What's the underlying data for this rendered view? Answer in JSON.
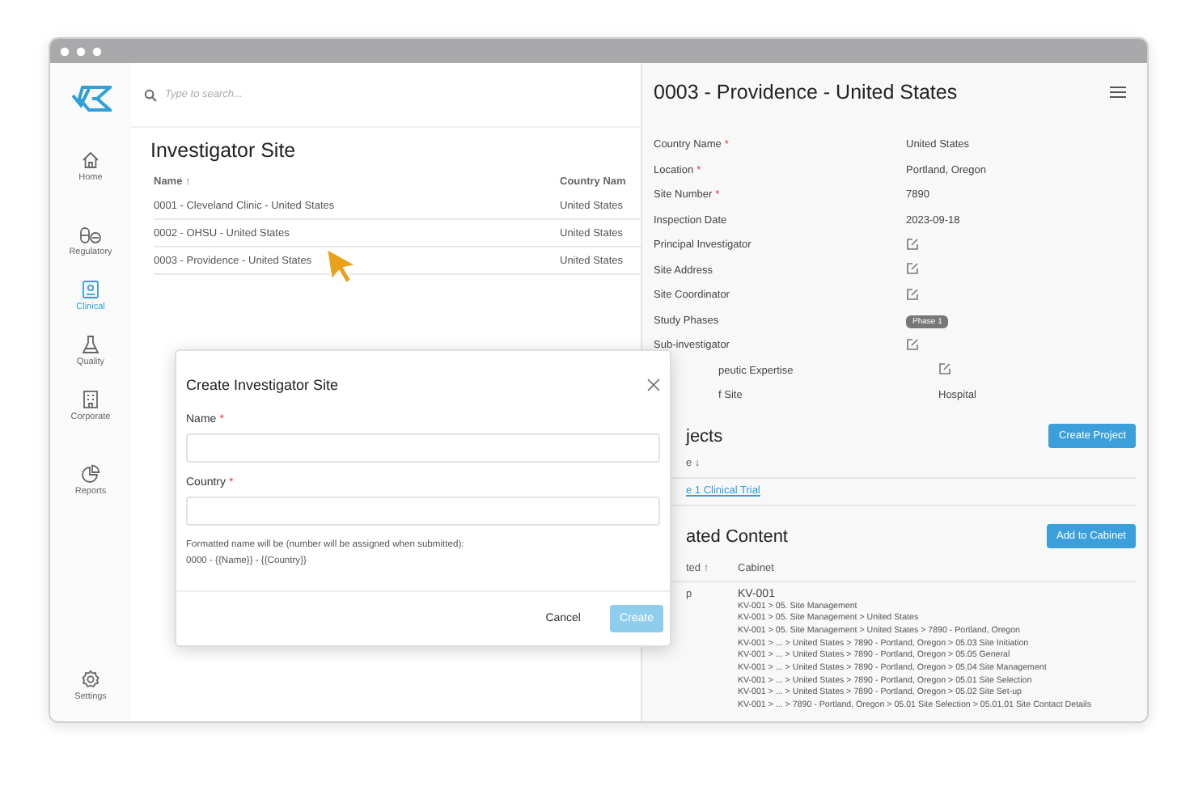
{
  "sidebar": {
    "groups": [
      [
        {
          "label": "Home",
          "selected": false
        }
      ],
      [
        {
          "label": "Regulatory",
          "selected": false
        },
        {
          "label": "Clinical",
          "selected": true
        },
        {
          "label": "Quality",
          "selected": false
        },
        {
          "label": "Corporate",
          "selected": false
        }
      ],
      [
        {
          "label": "Reports",
          "selected": false
        }
      ]
    ],
    "footer": {
      "label": "Settings",
      "selected": false
    }
  },
  "search": {
    "placeholder": "Type to search..."
  },
  "list": {
    "title": "Investigator Site",
    "columns": [
      "Name ↑",
      "Country Nam"
    ],
    "rows": [
      [
        "0001 - Cleveland Clinic - United States",
        "United States"
      ],
      [
        "0002 - OHSU - United States",
        "United States"
      ],
      [
        "0003 - Providence - United States",
        "United States"
      ]
    ]
  },
  "detail": {
    "title": "0003 - Providence - United States",
    "fields": [
      {
        "label": "Country Name",
        "required_mark": "*",
        "kind": "text",
        "value": "United States"
      },
      {
        "label": "Location",
        "required_mark": "*",
        "kind": "text",
        "value": "Portland, Oregon"
      },
      {
        "label": "Site Number",
        "required_mark": "*",
        "kind": "text",
        "value": "7890"
      },
      {
        "label": "Inspection Date",
        "kind": "text",
        "value": "2023-09-18"
      },
      {
        "label": "Principal Investigator",
        "kind": "edit"
      },
      {
        "label": "Site Address",
        "kind": "edit"
      },
      {
        "label": "Site Coordinator",
        "kind": "edit"
      },
      {
        "label": "Study Phases",
        "kind": "badge",
        "value": "Phase 1"
      },
      {
        "label": "Sub-investigator",
        "kind": "edit"
      },
      {
        "label": "peutic Expertise",
        "kind": "edit",
        "covered": true
      },
      {
        "label": "f Site",
        "kind": "text",
        "value": "Hospital",
        "covered": true
      }
    ]
  },
  "projects": {
    "title": "jects",
    "button": "Create Project",
    "column": "e ↓",
    "link": "e 1 Clinical Trial"
  },
  "related": {
    "title": "ated Content",
    "button": "Add to Cabinet",
    "columns": [
      "ted ↑",
      "Cabinet"
    ],
    "cell": "p",
    "cabinet_title": "KV-001",
    "paths": [
      "KV-001  > 05. Site Management",
      "KV-001  > 05. Site Management  > United States",
      "KV-001  > 05. Site Management  > United States  > 7890 - Portland, Oregon",
      "KV-001  > ... > United States  > 7890 - Portland, Oregon  > 05.03 Site Initiation",
      "KV-001  > ... > United States  > 7890 - Portland, Oregon  > 05.05 General",
      "KV-001  > ... > United States  > 7890 - Portland, Oregon  > 05.04 Site Management",
      "KV-001  > ... > United States  > 7890 - Portland, Oregon  > 05.01 Site Selection",
      "KV-001  > ... > United States  > 7890 - Portland, Oregon  > 05.02 Site Set-up",
      "KV-001  > ... > 7890 - Portland, Oregon  > 05.01 Site Selection  > 05.01.01 Site Contact Details"
    ]
  },
  "modal": {
    "title": "Create Investigator Site",
    "fields": [
      {
        "label": "Name",
        "required_mark": "*"
      },
      {
        "label": "Country",
        "required_mark": "*"
      }
    ],
    "note": [
      "Formatted name will be (number will be assigned when submitted):",
      "0000 - {{Name}} - {{Country}}"
    ],
    "buttons": [
      {
        "label": "Cancel",
        "kind": "plain",
        "disabled": false
      },
      {
        "label": "Create",
        "kind": "primary",
        "disabled": true
      }
    ]
  }
}
